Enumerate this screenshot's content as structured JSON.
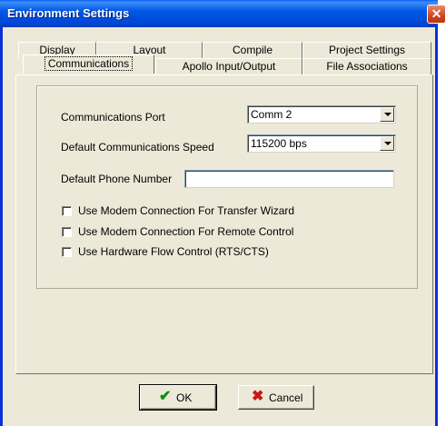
{
  "window": {
    "title": "Environment Settings",
    "close_glyph": "✕"
  },
  "tabs_row1": [
    "Display",
    "Layout",
    "Compile",
    "Project Settings"
  ],
  "tabs_row2": [
    "Communications",
    "Apollo Input/Output",
    "File Associations"
  ],
  "active_tab": "Communications",
  "form": {
    "port_label": "Communications Port",
    "port_value": "Comm 2",
    "speed_label": "Default Communications Speed",
    "speed_value": "115200 bps",
    "phone_label": "Default Phone Number",
    "phone_value": "",
    "checkboxes": [
      {
        "label": "Use Modem Connection For Transfer Wizard",
        "checked": false
      },
      {
        "label": "Use Modem Connection For Remote Control",
        "checked": false
      },
      {
        "label": "Use Hardware Flow Control (RTS/CTS)",
        "checked": false
      }
    ]
  },
  "buttons": {
    "ok_label": "OK",
    "cancel_label": "Cancel",
    "ok_icon": "✔",
    "cancel_icon": "✖"
  },
  "colors": {
    "titlebar": "#0058e6",
    "face": "#ece9d8",
    "close": "#d0451f",
    "ok_icon": "#108a10",
    "cancel_icon": "#c81818"
  }
}
